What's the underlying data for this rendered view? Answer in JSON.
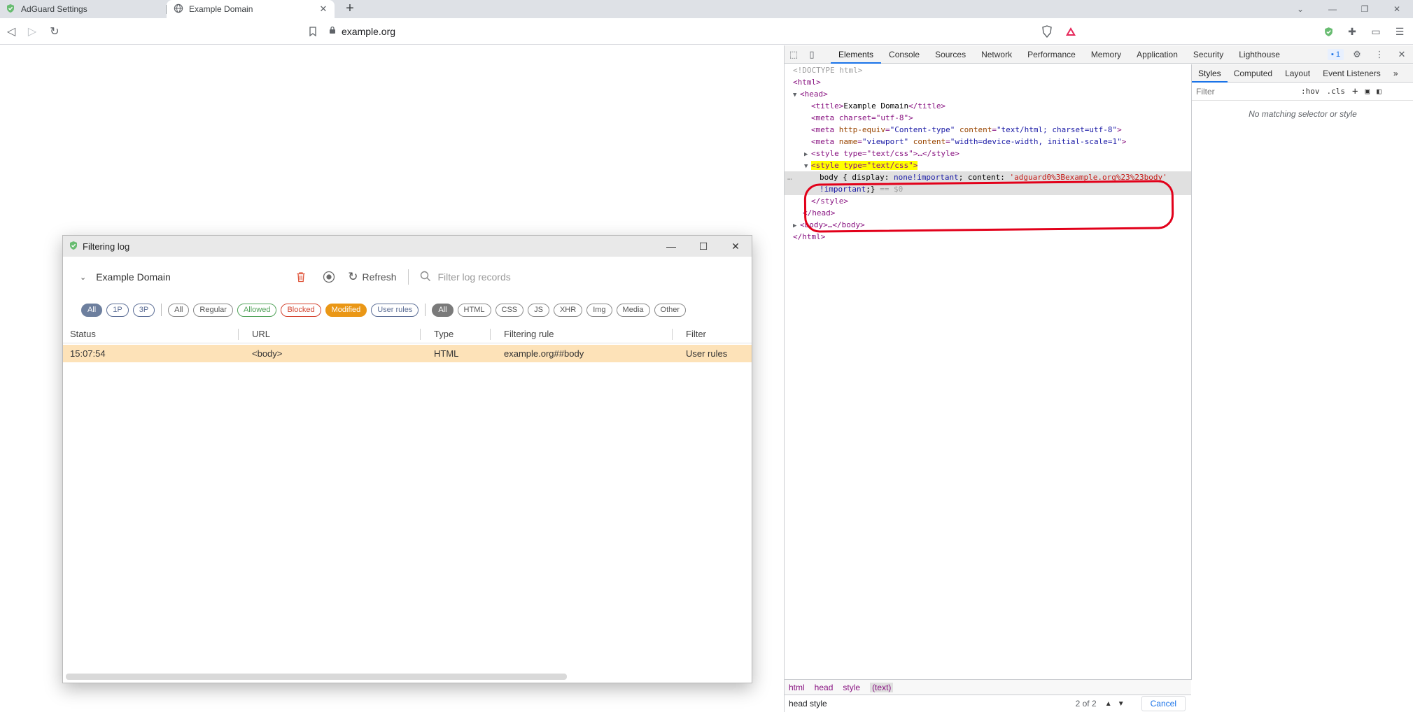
{
  "browser": {
    "tabs": [
      {
        "title": "AdGuard Settings",
        "active": false
      },
      {
        "title": "Example Domain",
        "active": true
      }
    ],
    "new_tab": "+",
    "address": "example.org"
  },
  "devtools": {
    "tabs": [
      "Elements",
      "Console",
      "Sources",
      "Network",
      "Performance",
      "Memory",
      "Application",
      "Security",
      "Lighthouse"
    ],
    "active_tab": "Elements",
    "issues_count": "1",
    "dom": {
      "doctype": "<!DOCTYPE html>",
      "html_open": "<html>",
      "head_open": "<head>",
      "title_line": "Example Domain",
      "meta1": "<meta charset=\"utf-8\">",
      "meta2_a": "http-equiv",
      "meta2_av": "\"Content-type\"",
      "meta2_b": "content",
      "meta2_bv": "\"text/html; charset=utf-8\"",
      "meta3_a": "name",
      "meta3_av": "\"viewport\"",
      "meta3_b": "content",
      "meta3_bv": "\"width=device-width, initial-scale=1\"",
      "style_collapsed": "<style type=\"text/css\">…</style>",
      "style_open": "<style type=\"text/css\">",
      "css_line1_a": "body { display: ",
      "css_line1_b": "none!important",
      "css_line1_c": "; content: ",
      "css_line1_d": "'adguard0%3Bexample.org%23%23body'",
      "css_line2_a": "!important",
      "css_line2_b": ";}",
      "css_line2_c": " == $0",
      "style_close": "</style>",
      "head_close": "</head>",
      "body_collapsed": "<body>…</body>",
      "html_close": "</html>"
    },
    "styles_tabs": [
      "Styles",
      "Computed",
      "Layout",
      "Event Listeners"
    ],
    "styles_filter_placeholder": "Filter",
    "styles_hov": ":hov",
    "styles_cls": ".cls",
    "styles_empty": "No matching selector or style",
    "breadcrumbs": [
      "html",
      "head",
      "style",
      "(text)"
    ],
    "search_query": "head style",
    "search_count": "2 of 2",
    "search_cancel": "Cancel"
  },
  "filtering_log": {
    "window_title": "Filtering log",
    "domain": "Example Domain",
    "refresh_label": "Refresh",
    "search_placeholder": "Filter log records",
    "chips_party": [
      "All",
      "1P",
      "3P"
    ],
    "chips_status": [
      "All",
      "Regular",
      "Allowed",
      "Blocked",
      "Modified",
      "User rules"
    ],
    "chips_type": [
      "All",
      "HTML",
      "CSS",
      "JS",
      "XHR",
      "Img",
      "Media",
      "Other"
    ],
    "columns": [
      "Status",
      "URL",
      "Type",
      "Filtering rule",
      "Filter"
    ],
    "rows": [
      {
        "status": "15:07:54",
        "url": "<body>",
        "type": "HTML",
        "rule": "example.org##body",
        "filter": "User rules"
      }
    ]
  },
  "colors": {
    "modified": "#ea9716",
    "row_highlight": "#fde2b8",
    "annotation_ring": "#e2001a",
    "selected_party_chip": "#6d7f9e"
  }
}
